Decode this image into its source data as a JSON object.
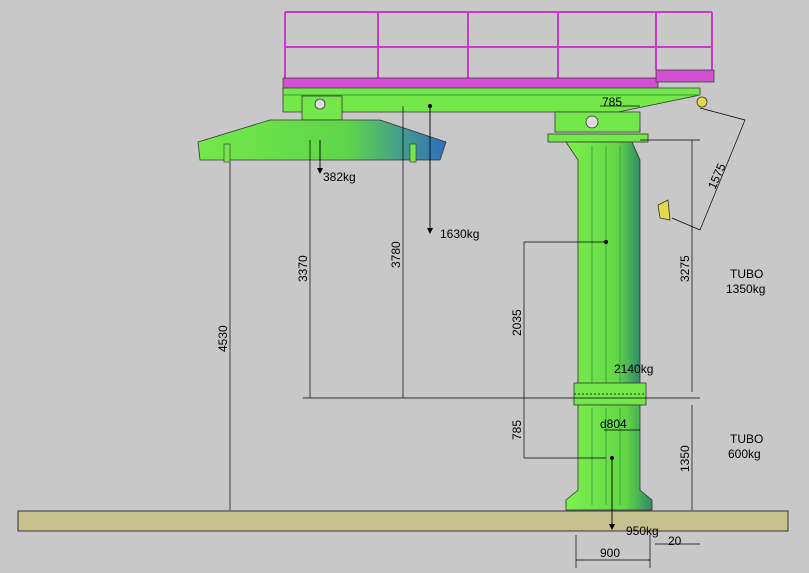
{
  "colors": {
    "background": "#c8c8c8",
    "steel_green": "#74e84a",
    "steel_green_dark": "#2f9a3a",
    "railing_magenta": "#c83ac8",
    "deck_magenta": "#d24fd2",
    "floor": "#c7c18f",
    "blue_shade": "#2f6dbf"
  },
  "loads": {
    "left_box": "382kg",
    "mid": "1630kg",
    "joint": "2140kg",
    "base": "950kg"
  },
  "tubes": {
    "upper_name": "TUBO",
    "upper_weight": "1350kg",
    "lower_name": "TUBO",
    "lower_weight": "600kg"
  },
  "dimensions": {
    "top_785": "785",
    "diag_1575": "1575",
    "h_4530": "4530",
    "h_3370": "3370",
    "h_3780": "3780",
    "h_2035": "2035",
    "h_3275": "3275",
    "h_785": "785",
    "h_1350": "1350",
    "dia_804": "d804",
    "w_900": "900",
    "w_20": "20"
  }
}
